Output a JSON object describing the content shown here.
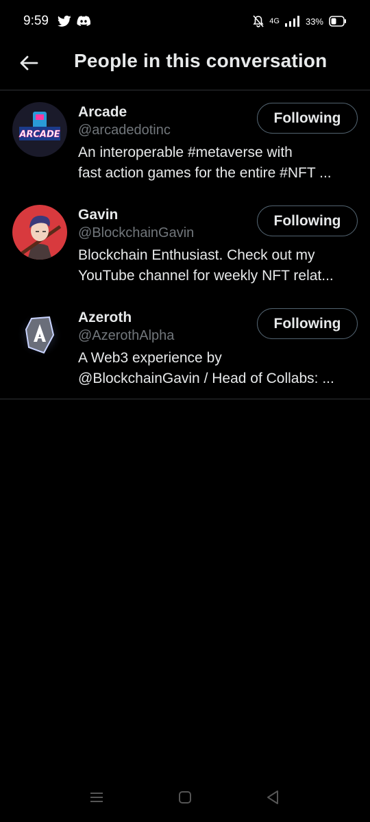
{
  "status_bar": {
    "time": "9:59",
    "network": "4G",
    "battery": "33%",
    "icons": [
      "twitter-icon",
      "discord-icon",
      "mute-icon",
      "signal-icon",
      "battery-icon"
    ]
  },
  "header": {
    "title": "People in this conversation",
    "back_icon": "back-arrow-icon"
  },
  "users": [
    {
      "name": "Arcade",
      "handle": "@arcadedotinc",
      "bio_line1": "An interoperable #metaverse with",
      "bio_line2": "fast action games for the entire #NFT ...",
      "button_label": "Following",
      "avatar_text": "ARCADE"
    },
    {
      "name": "Gavin",
      "handle": "@BlockchainGavin",
      "bio_line1": "Blockchain Enthusiast. Check out my",
      "bio_line2": "YouTube channel for weekly NFT relat...",
      "button_label": "Following"
    },
    {
      "name": "Azeroth",
      "handle": "@AzerothAlpha",
      "bio_line1": "A Web3 experience by",
      "bio_line2": "@BlockchainGavin / Head of Collabs: ...",
      "button_label": "Following"
    }
  ],
  "colors": {
    "background": "#000000",
    "text_primary": "#e7e9ea",
    "text_secondary": "#71767b",
    "divider": "#2f3336",
    "button_border": "#536471"
  },
  "nav_bar": {
    "icons": [
      "recents-icon",
      "home-icon",
      "back-icon"
    ]
  }
}
